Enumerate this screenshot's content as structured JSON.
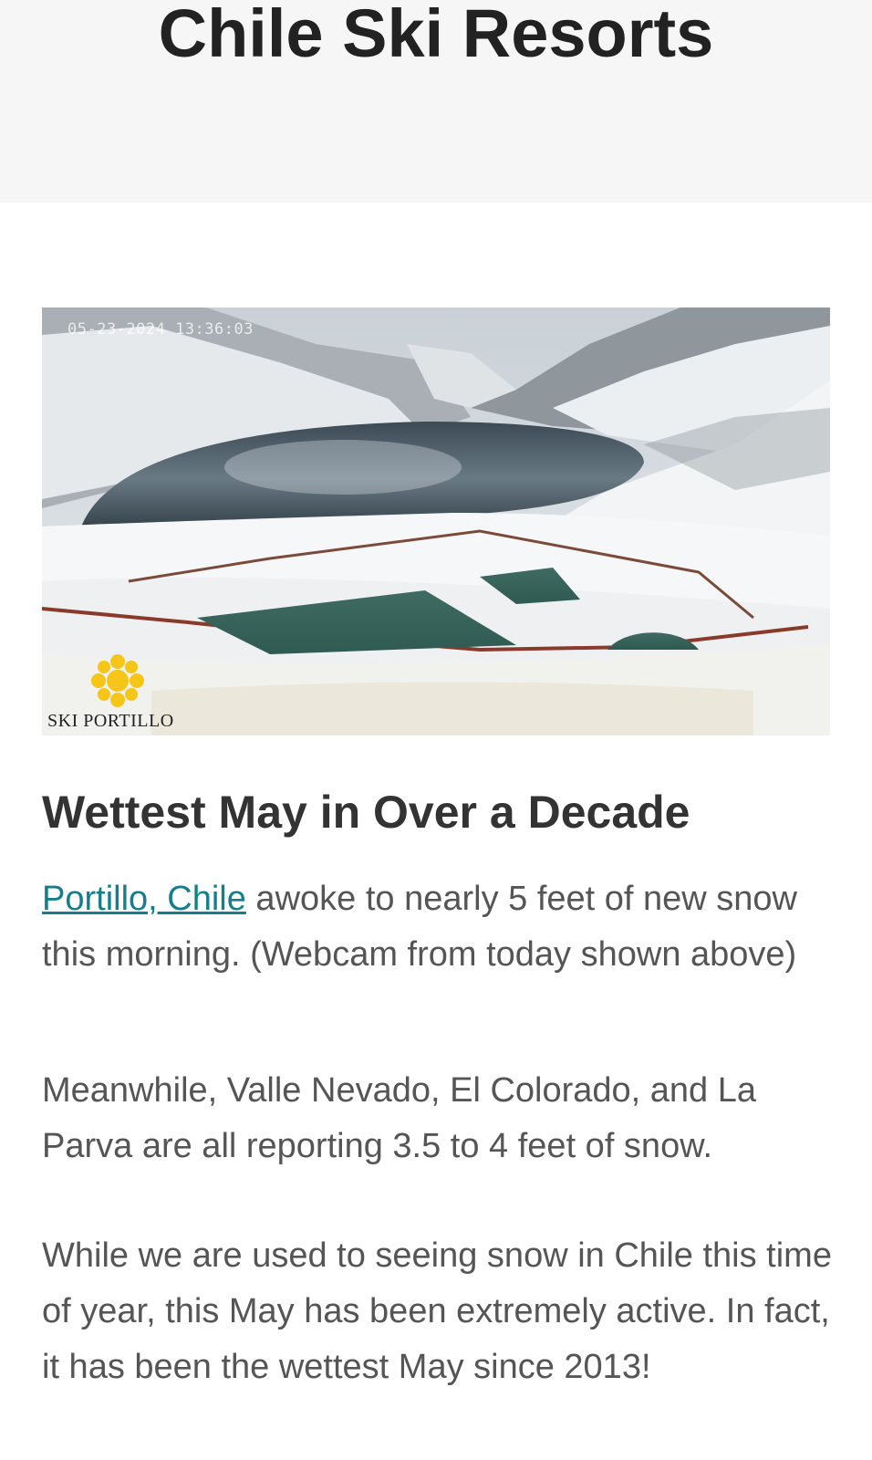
{
  "header": {
    "title": "Chile Ski Resorts"
  },
  "hero": {
    "cam_timestamp": "05-23-2024 13:36:03",
    "logo_text": "SKI PORTILLO",
    "logo_icon": "sun-logo-icon",
    "logo_color": "#f5c518"
  },
  "article": {
    "title": "Wettest May in Over a Decade",
    "p1_link": "Portillo, Chile",
    "p1_text": " awoke to nearly 5 feet of new snow this morning. (Webcam from today shown above)",
    "p2": "Meanwhile, Valle Nevado, El Colorado, and La Parva are all reporting 3.5 to 4 feet of snow.",
    "p3": "While we are used to seeing snow in Chile this time of year, this May has been extremely active. In fact, it has been the wettest May since 2013!",
    "link_color": "#147f8a"
  }
}
